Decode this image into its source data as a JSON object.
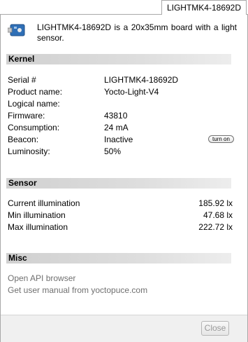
{
  "tab": {
    "label": "LIGHTMK4-18692D"
  },
  "header": {
    "description": "LIGHTMK4-18692D is a 20x35mm board with a light sensor.",
    "icon": "device-board-icon"
  },
  "kernel": {
    "title": "Kernel",
    "rows": [
      {
        "label": "Serial #",
        "value": "LIGHTMK4-18692D"
      },
      {
        "label": "Product name:",
        "value": "Yocto-Light-V4"
      },
      {
        "label": "Logical name:",
        "value": ""
      },
      {
        "label": "Firmware:",
        "value": "43810"
      },
      {
        "label": "Consumption:",
        "value": "24 mA"
      },
      {
        "label": "Beacon:",
        "value": "Inactive"
      },
      {
        "label": "Luminosity:",
        "value": "50%"
      }
    ],
    "beacon_button": "turn on"
  },
  "sensor": {
    "title": "Sensor",
    "rows": [
      {
        "label": "Current illumination",
        "value": "185.92 lx"
      },
      {
        "label": "Min illumination",
        "value": "47.68 lx"
      },
      {
        "label": "Max illumination",
        "value": "222.72 lx"
      }
    ]
  },
  "misc": {
    "title": "Misc",
    "links": [
      "Open API browser",
      "Get user manual from yoctopuce.com"
    ]
  },
  "footer": {
    "close_label": "Close"
  }
}
